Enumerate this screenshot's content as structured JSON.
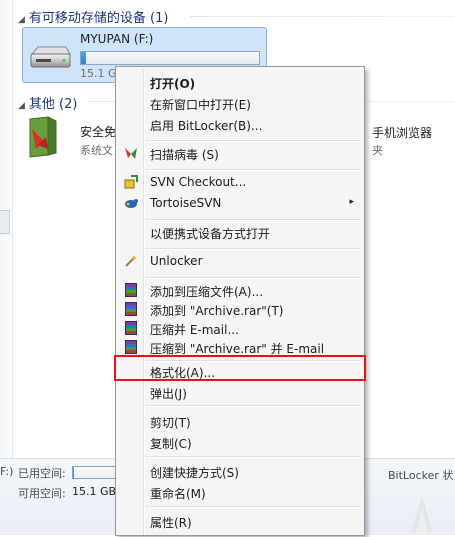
{
  "groups": {
    "removable": {
      "title": "有可移动存储的设备 (1)"
    },
    "other": {
      "title": "其他 (2)"
    }
  },
  "drive": {
    "name": "MYUPAN (F:)",
    "size": "15.1 G",
    "fill": 0.03
  },
  "others": {
    "item1": {
      "name": "安全免",
      "sub": "系统文"
    },
    "item2": {
      "name": "手机浏览器",
      "sub": "夹"
    }
  },
  "footer": {
    "drive_prefix": "F:)",
    "used_label": "已用空间:",
    "free_label": "可用空间:",
    "free_value": "15.1 GB",
    "used_fill": 0.03,
    "bitlocker": "BitLocker 状"
  },
  "menu": {
    "open": "打开(O)",
    "open_new_window": "在新窗口中打开(E)",
    "bitlocker": "启用 BitLocker(B)...",
    "scan": "扫描病毒 (S)",
    "svn_checkout": "SVN Checkout...",
    "tortoise": "TortoiseSVN",
    "portable_open": "以便携式设备方式打开",
    "unlocker": "Unlocker",
    "add_archive": "添加到压缩文件(A)...",
    "add_rar": "添加到 \"Archive.rar\"(T)",
    "compress_email": "压缩并 E-mail...",
    "compress_rar_email": "压缩到 \"Archive.rar\" 并 E-mail",
    "format": "格式化(A)...",
    "eject": "弹出(J)",
    "cut": "剪切(T)",
    "copy": "复制(C)",
    "shortcut": "创建快捷方式(S)",
    "rename": "重命名(M)",
    "properties": "属性(R)"
  },
  "icons": {
    "tortoise_arrow": "▸",
    "group_toggle": "◢"
  },
  "colors": {
    "highlight": "#e0121c",
    "selection": "#cfe4fb"
  }
}
